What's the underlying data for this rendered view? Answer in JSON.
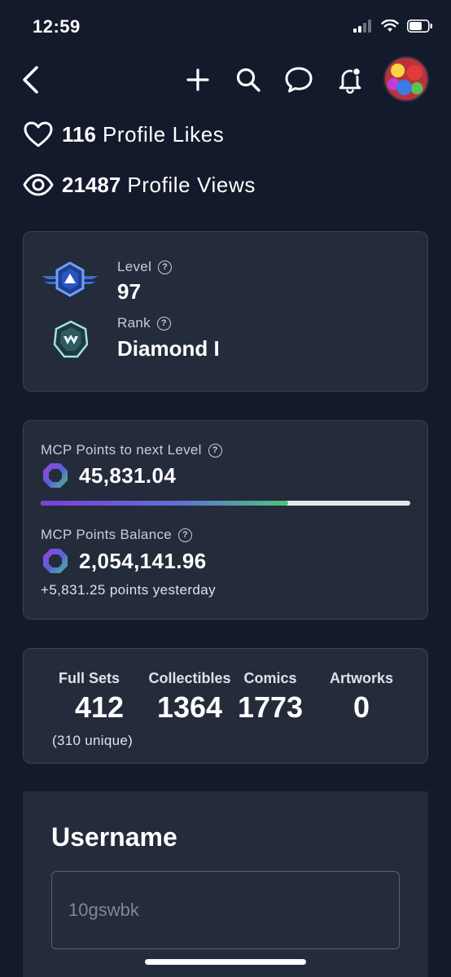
{
  "status_bar": {
    "time": "12:59",
    "icons": [
      "cellular-signal-icon",
      "wifi-icon",
      "battery-icon"
    ]
  },
  "nav": {
    "icons": [
      "back-chevron-icon",
      "plus-icon",
      "search-icon",
      "chat-bubble-icon",
      "notification-bell-icon"
    ]
  },
  "profile_stats": {
    "likes_count": "116",
    "likes_label": "Profile Likes",
    "views_count": "21487",
    "views_label": "Profile Views"
  },
  "level_card": {
    "level_label": "Level",
    "level_value": "97",
    "rank_label": "Rank",
    "rank_value": "Diamond I",
    "help_glyph": "?"
  },
  "points_card": {
    "to_next_label": "MCP Points to next Level",
    "to_next_value": "45,831.04",
    "progress_fraction": 0.67,
    "balance_label": "MCP Points Balance",
    "balance_value": "2,054,141.96",
    "yesterday_text": "+5,831.25 points yesterday"
  },
  "collection_card": {
    "columns": [
      {
        "label": "Full Sets",
        "value": "412"
      },
      {
        "label": "Collectibles",
        "value": "1364"
      },
      {
        "label": "Comics",
        "value": "1773"
      },
      {
        "label": "Artworks",
        "value": "0"
      }
    ],
    "unique_text": "(310 unique)"
  },
  "username_section": {
    "title": "Username",
    "value": "10gswbk"
  },
  "colors": {
    "background": "#131a2b",
    "card": "#242b3b",
    "card_border": "#3a4254",
    "progress_start": "#7b3fd6",
    "progress_end": "#4fc37d"
  }
}
